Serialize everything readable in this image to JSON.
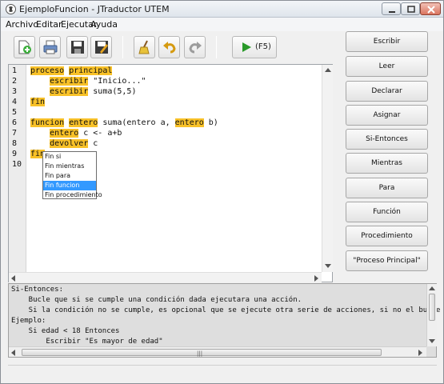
{
  "window": {
    "title": "EjemploFuncion - JTraductor UTEM"
  },
  "menu": [
    "Archivo",
    "Editar",
    "Ejecutar",
    "Ayuda"
  ],
  "toolbar": {
    "buttons": [
      "new-file-icon",
      "print-icon",
      "save-icon",
      "save-as-icon",
      "clean-icon",
      "undo-icon",
      "redo-icon",
      "run-icon"
    ],
    "run_label": "(F5)"
  },
  "editor": {
    "line_numbers": [
      "1",
      "2",
      "3",
      "4",
      "5",
      "6",
      "7",
      "8",
      "9",
      "10"
    ],
    "code": {
      "l1_kw1": "proceso",
      "l1_kw2": "principal",
      "l2_kw": "escribir",
      "l2_rest": " \"Inicio...\"",
      "l3_kw": "escribir",
      "l3_rest": " suma(5,5)",
      "l4_kw": "fin",
      "l6_kw1": "funcion",
      "l6_kw2": "entero",
      "l6_mid": " suma(entero a, ",
      "l6_kw3": "entero",
      "l6_end": " b)",
      "l7_kw": "entero",
      "l7_rest": " c <- a+b",
      "l8_kw": "devolver",
      "l8_rest": " c",
      "l9_kw": "fin"
    }
  },
  "autocomplete": {
    "items": [
      "Fin si",
      "Fin mientras",
      "Fin para",
      "Fin funcion",
      "Fin procedimiento"
    ],
    "selected": "Fin funcion"
  },
  "sidebar": {
    "buttons": [
      "Escribir",
      "Leer",
      "Declarar",
      "Asignar",
      "Si-Entonces",
      "Mientras",
      "Para",
      "Función",
      "Procedimiento",
      "\"Proceso Principal\""
    ]
  },
  "help": {
    "lines": [
      "Si-Entonces:",
      "    Bucle que si se cumple una condición dada ejecutara una acción.",
      "    Si la condición no se cumple, es opcional que se ejecute otra serie de acciones, si no el bucle",
      "Ejemplo:",
      "    Si edad < 18 Entonces",
      "        Escribir \"Es mayor de edad\""
    ]
  },
  "colors": {
    "keyword_highlight": "#f8c128",
    "selection": "#3399ff"
  }
}
